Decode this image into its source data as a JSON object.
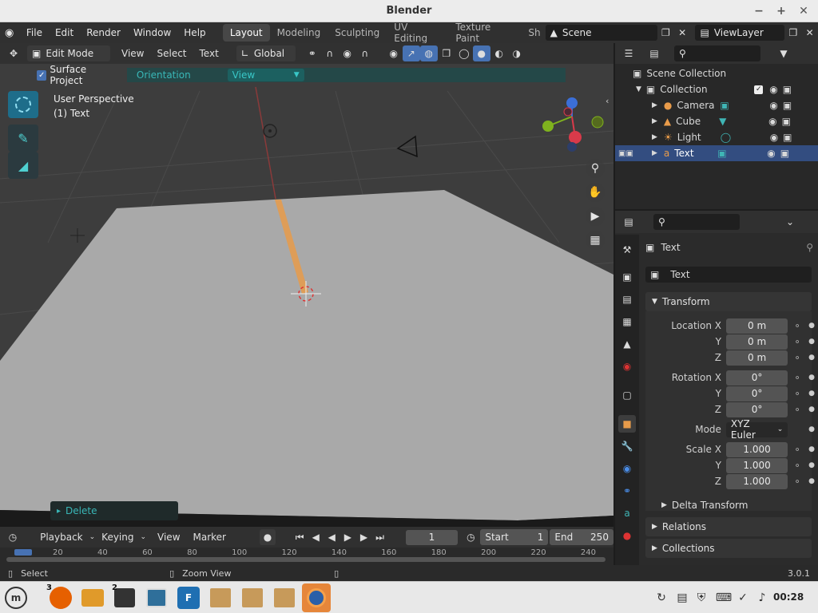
{
  "window": {
    "title": "Blender"
  },
  "menubar": {
    "items": [
      "File",
      "Edit",
      "Render",
      "Window",
      "Help"
    ]
  },
  "workspaces": [
    "Layout",
    "Modeling",
    "Sculpting",
    "UV Editing",
    "Texture Paint",
    "Sh"
  ],
  "scene": {
    "name": "Scene",
    "view_layer": "ViewLayer"
  },
  "viewport": {
    "mode": "Edit Mode",
    "menus": [
      "View",
      "Select",
      "Text"
    ],
    "orientation_label": "Global",
    "surface_project_label": "Surface Project",
    "orientation_field_label": "Orientation",
    "orientation_value": "View",
    "perspective": "User Perspective",
    "object_label": "(1) Text",
    "last_op": "Delete"
  },
  "outliner": {
    "root": "Scene Collection",
    "collection": "Collection",
    "objects": [
      {
        "name": "Camera",
        "icon": "camera-icon"
      },
      {
        "name": "Cube",
        "icon": "mesh-icon"
      },
      {
        "name": "Light",
        "icon": "light-icon"
      },
      {
        "name": "Text",
        "icon": "text-icon"
      }
    ]
  },
  "properties": {
    "header_name": "Text",
    "object_name": "Text",
    "transform_title": "Transform",
    "location_x_label": "Location X",
    "location_x": "0 m",
    "y_label": "Y",
    "z_label": "Z",
    "location_y": "0 m",
    "location_z": "0 m",
    "rotation_x_label": "Rotation X",
    "rotation_x": "0°",
    "rotation_y": "0°",
    "rotation_z": "0°",
    "mode_label": "Mode",
    "mode_value": "XYZ Euler",
    "scale_x_label": "Scale X",
    "scale_x": "1.000",
    "scale_y": "1.000",
    "scale_z": "1.000",
    "delta_transform": "Delta Transform",
    "relations": "Relations",
    "collections": "Collections"
  },
  "timeline": {
    "menus": [
      "Playback",
      "Keying",
      "View",
      "Marker"
    ],
    "current_frame": "1",
    "start_label": "Start",
    "start": "1",
    "end_label": "End",
    "end": "250",
    "ruler": [
      "20",
      "40",
      "60",
      "80",
      "100",
      "120",
      "140",
      "160",
      "180",
      "200",
      "220",
      "240"
    ]
  },
  "status": {
    "left": "Select",
    "middle": "Zoom View",
    "version": "3.0.1"
  },
  "taskbar": {
    "clock": "00:28",
    "badge_firefox": "3",
    "badge_terminal": "2"
  },
  "colors": {
    "accent": "#1e6d8a",
    "selection": "#334d80",
    "orange": "#e89b4a"
  }
}
